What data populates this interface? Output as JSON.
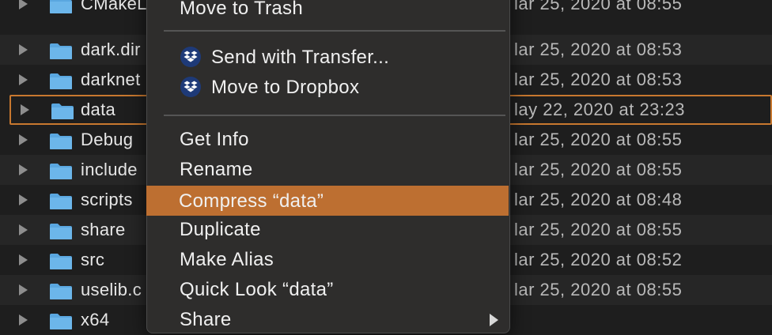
{
  "finder": {
    "rows": [
      {
        "name": "CMakeL",
        "date": "lar 25, 2020 at 08:55"
      },
      {
        "name": "dark.dir",
        "date": "lar 25, 2020 at 08:53"
      },
      {
        "name": "darknet",
        "date": "lar 25, 2020 at 08:53"
      },
      {
        "name": "data",
        "date": "lay 22, 2020 at 23:23"
      },
      {
        "name": "Debug",
        "date": "lar 25, 2020 at 08:55"
      },
      {
        "name": "include",
        "date": "lar 25, 2020 at 08:55"
      },
      {
        "name": "scripts",
        "date": "lar 25, 2020 at 08:48"
      },
      {
        "name": "share",
        "date": "lar 25, 2020 at 08:55"
      },
      {
        "name": "src",
        "date": "lar 25, 2020 at 08:52"
      },
      {
        "name": "uselib.c",
        "date": "lar 25, 2020 at 08:55"
      },
      {
        "name": "x64",
        "date": ""
      }
    ]
  },
  "context_menu": {
    "move_to_trash": "Move to Trash",
    "send_with_transfer": "Send with Transfer...",
    "move_to_dropbox": "Move to Dropbox",
    "get_info": "Get Info",
    "rename": "Rename",
    "compress": "Compress “data”",
    "duplicate": "Duplicate",
    "make_alias": "Make Alias",
    "quick_look": "Quick Look “data”",
    "share": "Share"
  },
  "colors": {
    "highlight": "#bd6f31",
    "selection_outline": "#c8782f",
    "folder": "#5aa7e0"
  }
}
